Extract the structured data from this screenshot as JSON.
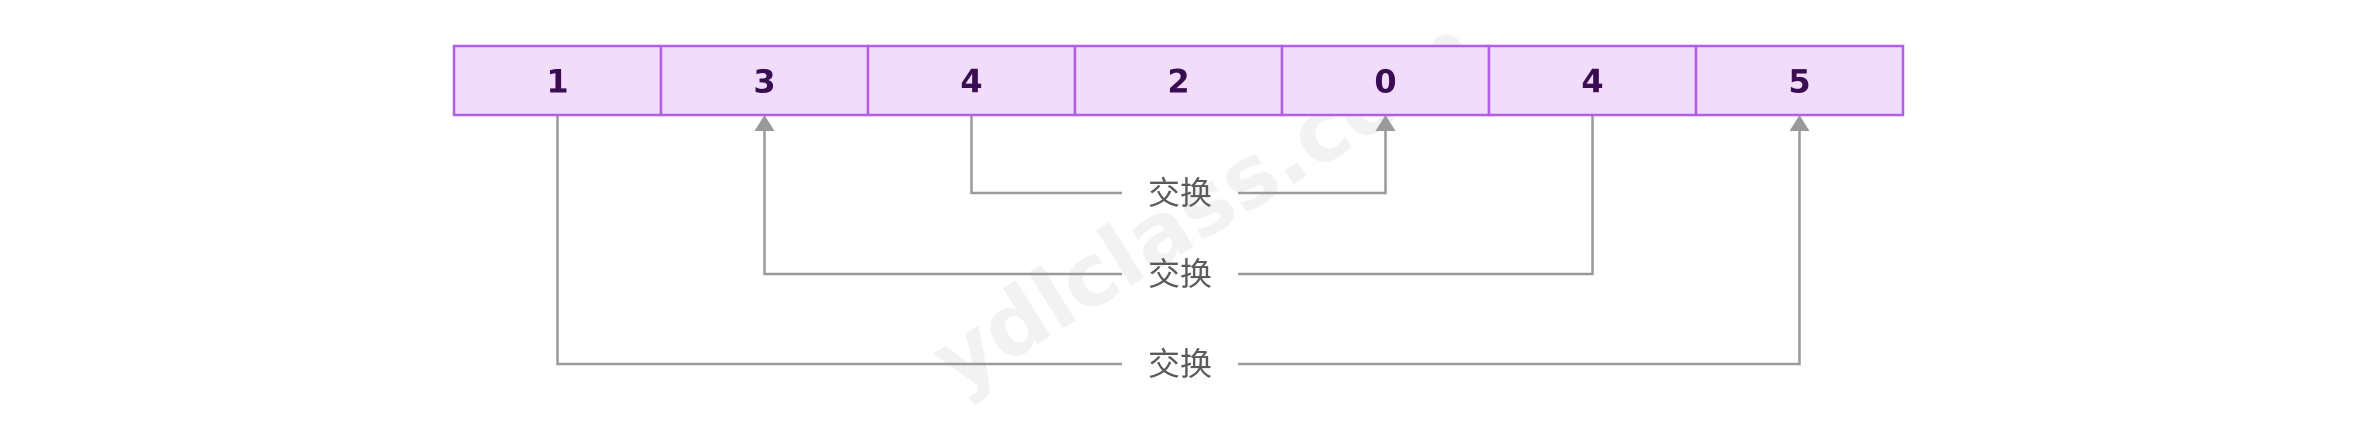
{
  "array": {
    "cells": [
      "1",
      "3",
      "4",
      "2",
      "0",
      "4",
      "5"
    ]
  },
  "swaps": [
    {
      "label": "交换",
      "from_index": 2,
      "to_index": 4
    },
    {
      "label": "交换",
      "from_index": 5,
      "to_index": 1
    },
    {
      "label": "交换",
      "from_index": 0,
      "to_index": 6
    }
  ],
  "watermark": "ydlclass.com",
  "colors": {
    "cell_fill": "#f1dcfb",
    "cell_border": "#b25ee6",
    "cell_text": "#3a0c52",
    "connector": "#9a9a9a",
    "swap_text": "#5a5a5a"
  }
}
